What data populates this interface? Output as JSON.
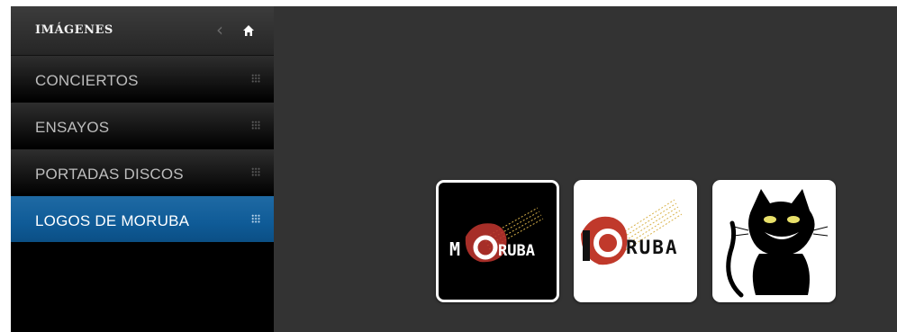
{
  "sidebar": {
    "title": "IMÁGENES",
    "items": [
      {
        "label": "CONCIERTOS",
        "active": false
      },
      {
        "label": "ENSAYOS",
        "active": false
      },
      {
        "label": "PORTADAS DISCOS",
        "active": false
      },
      {
        "label": "LOGOS DE MORUBA",
        "active": true
      }
    ]
  },
  "gallery": {
    "thumbnails": [
      {
        "logo_text": "M",
        "logo_text_tail": "RUBA",
        "style": "light-on-dark"
      },
      {
        "logo_text_tail": "RUBA",
        "style": "dark-on-light"
      },
      {
        "image": "black-cat"
      }
    ]
  },
  "colors": {
    "active_item": "#0f5b97",
    "background": "#333333",
    "sidebar": "#000000",
    "logo_red": "#c0392b"
  },
  "icons": {
    "back": "chevron-left-icon",
    "home": "home-icon",
    "grip": "grip-icon"
  }
}
